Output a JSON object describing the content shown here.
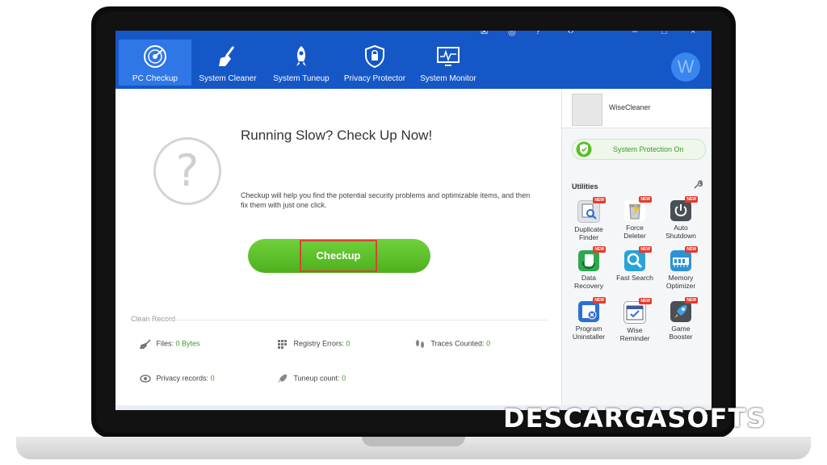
{
  "nav": {
    "items": [
      {
        "label": "PC Checkup",
        "icon": "radar-icon"
      },
      {
        "label": "System Cleaner",
        "icon": "broom-icon"
      },
      {
        "label": "System Tuneup",
        "icon": "rocket-icon"
      },
      {
        "label": "Privacy Protector",
        "icon": "shield-icon"
      },
      {
        "label": "System Monitor",
        "icon": "monitor-icon"
      }
    ],
    "avatar_letter": "W"
  },
  "main": {
    "headline": "Running Slow? Check Up Now!",
    "description": "Checkup will help you find the potential security problems and optimizable items, and then fix them with just one click.",
    "checkup_button": "Checkup",
    "clean_record_label": "Clean Record",
    "stats": {
      "files_label": "Files:",
      "files_value": "0 Bytes",
      "registry_label": "Registry Errors:",
      "registry_value": "0",
      "traces_label": "Traces Counted:",
      "traces_value": "0",
      "privacy_label": "Privacy records:",
      "privacy_value": "0",
      "tuneup_label": "Tuneup count:",
      "tuneup_value": "0"
    }
  },
  "side": {
    "user_name": "WiseCleaner",
    "protection_status": "System Protection On",
    "utilities_title": "Utilities",
    "new_badge": "NEW",
    "utilities": [
      {
        "line1": "Duplicate",
        "line2": "Finder"
      },
      {
        "line1": "Force",
        "line2": "Deleter"
      },
      {
        "line1": "Auto",
        "line2": "Shutdown"
      },
      {
        "line1": "Data",
        "line2": "Recovery"
      },
      {
        "line1": "Fast Search",
        "line2": ""
      },
      {
        "line1": "Memory",
        "line2": "Optimizer"
      },
      {
        "line1": "Program",
        "line2": "Uninstaller"
      },
      {
        "line1": "Wise",
        "line2": "Reminder"
      },
      {
        "line1": "Game",
        "line2": "Booster"
      }
    ]
  },
  "watermark": "DESCARGASOFTS",
  "colors": {
    "nav_blue": "#1557c6",
    "accent_green": "#5bbd27",
    "highlight_red": "#d8452f"
  }
}
